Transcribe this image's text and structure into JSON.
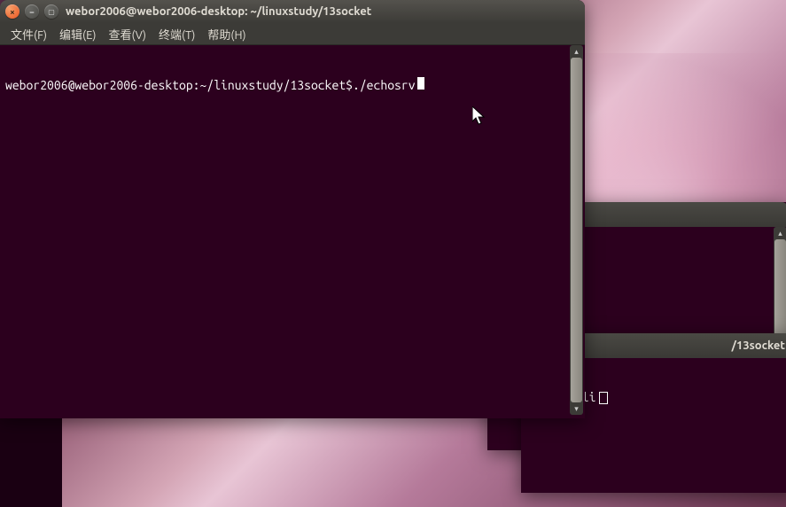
{
  "front_window": {
    "title": "webor2006@webor2006-desktop: ~/linuxstudy/13socket",
    "prompt": "webor2006@webor2006-desktop:~/linuxstudy/13socket$",
    "command": "./echosrv"
  },
  "back_window2": {
    "title_fragment": "/13socket",
    "visible_text": "chocli"
  },
  "menubar": {
    "file": "文件(F)",
    "edit": "编辑(E)",
    "view": "查看(V)",
    "terminal": "终端(T)",
    "help": "帮助(H)"
  },
  "controls": {
    "close": "×",
    "min": "−",
    "max": "▢"
  }
}
